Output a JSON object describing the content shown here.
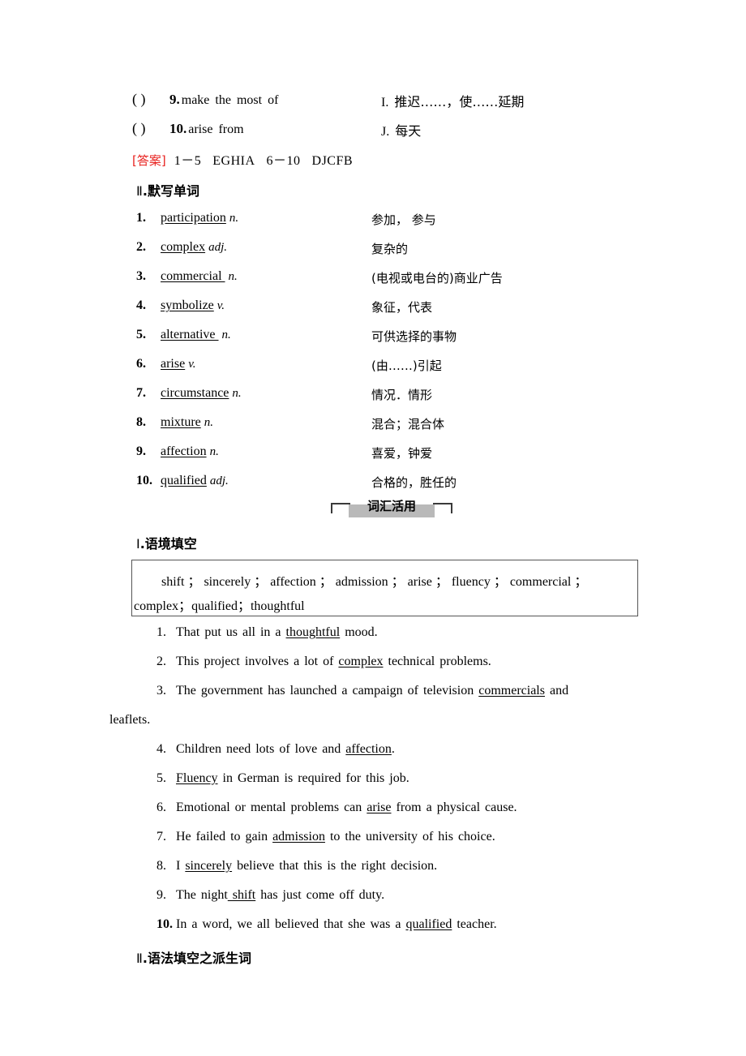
{
  "matching": {
    "items": [
      {
        "blank": "(        )",
        "number": "9.",
        "phrase": "make  the  most  of",
        "letter": "I.",
        "meaning": "推迟……，使……延期"
      },
      {
        "blank": "(        )",
        "number": "10.",
        "phrase": "arise  from",
        "letter": "J.",
        "meaning": "每天"
      }
    ],
    "answer_tag": "[答案]",
    "answer_text_1": "1－5",
    "answer_text_2": "EGHIA",
    "answer_text_3": "6－10",
    "answer_text_4": "DJCFB",
    "answer_tag_color": "#e8221f"
  },
  "dictation": {
    "heading_numeral": "Ⅱ",
    "heading_title": ".默写单词",
    "rows": [
      {
        "index": "1.",
        "word": "participation",
        "pos": "n.",
        "meaning": "参加， 参与"
      },
      {
        "index": "2.",
        "word": "complex",
        "pos": "adj.",
        "meaning": "复杂的"
      },
      {
        "index": "3.",
        "word": "commercial ",
        "pos": "n.",
        "meaning": "(电视或电台的)商业广告"
      },
      {
        "index": "4.",
        "word": "symbolize",
        "pos": "v.",
        "meaning": "象征，代表"
      },
      {
        "index": "5.",
        "word": "alternative ",
        "pos": "n.",
        "meaning": "可供选择的事物"
      },
      {
        "index": "6.",
        "word": "arise",
        "pos": "v.",
        "meaning": "(由……)引起"
      },
      {
        "index": "7.",
        "word": "circumstance",
        "pos": "n.",
        "meaning": "情况．情形"
      },
      {
        "index": "8.",
        "word": "mixture",
        "pos": "n.",
        "meaning": "混合；混合体"
      },
      {
        "index": "9.",
        "word": "affection",
        "pos": "n.",
        "meaning": "喜爱，钟爱"
      },
      {
        "index": "10.",
        "word": "qualified",
        "pos": "adj.",
        "meaning": "合格的，胜任的"
      }
    ]
  },
  "band": {
    "label": "词汇活用",
    "plate_color": "#b9b9b9",
    "bracket_color": "#3a3a3a"
  },
  "cloze": {
    "heading_numeral": "Ⅰ",
    "heading_title": ".语境填空",
    "wordbank_line1": "shift ； sincerely ； affection ； admission ； arise ； fluency ； commercial ；",
    "wordbank_line2": "complex；qualified；thoughtful",
    "sentences": [
      {
        "n": "1.",
        "bold": false,
        "pre": "That  put  us  all  in  a  ",
        "answer": "thoughtful",
        "post": "  mood."
      },
      {
        "n": "2.",
        "bold": false,
        "pre": "This  project  involves  a  lot  of  ",
        "answer": "complex",
        "post": "  technical  problems."
      },
      {
        "n": "3.",
        "bold": false,
        "pre": "The  government  has  launched  a  campaign  of  television  ",
        "answer": "commercials",
        "post": "  and",
        "cont": "leaflets."
      },
      {
        "n": "4.",
        "bold": false,
        "pre": "Children  need  lots  of  love  and  ",
        "answer": "affection",
        "post": "."
      },
      {
        "n": "5.",
        "bold": false,
        "pre": "",
        "answer": "Fluency",
        "post": "  in  German  is  required  for  this  job."
      },
      {
        "n": "6.",
        "bold": false,
        "pre": "Emotional  or  mental  problems  can  ",
        "answer": "arise",
        "post": "  from  a  physical  cause."
      },
      {
        "n": "7.",
        "bold": false,
        "pre": "He  failed  to  gain ",
        "answer": "admission",
        "post": "  to  the  university  of  his  choice."
      },
      {
        "n": "8.",
        "bold": false,
        "pre": "I  ",
        "answer": "sincerely",
        "post": "  believe  that  this  is  the  right  decision."
      },
      {
        "n": "9.",
        "bold": false,
        "pre": "The  night",
        "answer": " shift",
        "post": "  has  just  come  off  duty."
      },
      {
        "n": "10.",
        "bold": true,
        "pre": "In  a  word,  we  all  believed  that  she  was  a  ",
        "answer": "qualified",
        "post": "  teacher."
      }
    ]
  },
  "grammar": {
    "heading_numeral": "Ⅱ",
    "heading_title": ".语法填空之派生词"
  }
}
